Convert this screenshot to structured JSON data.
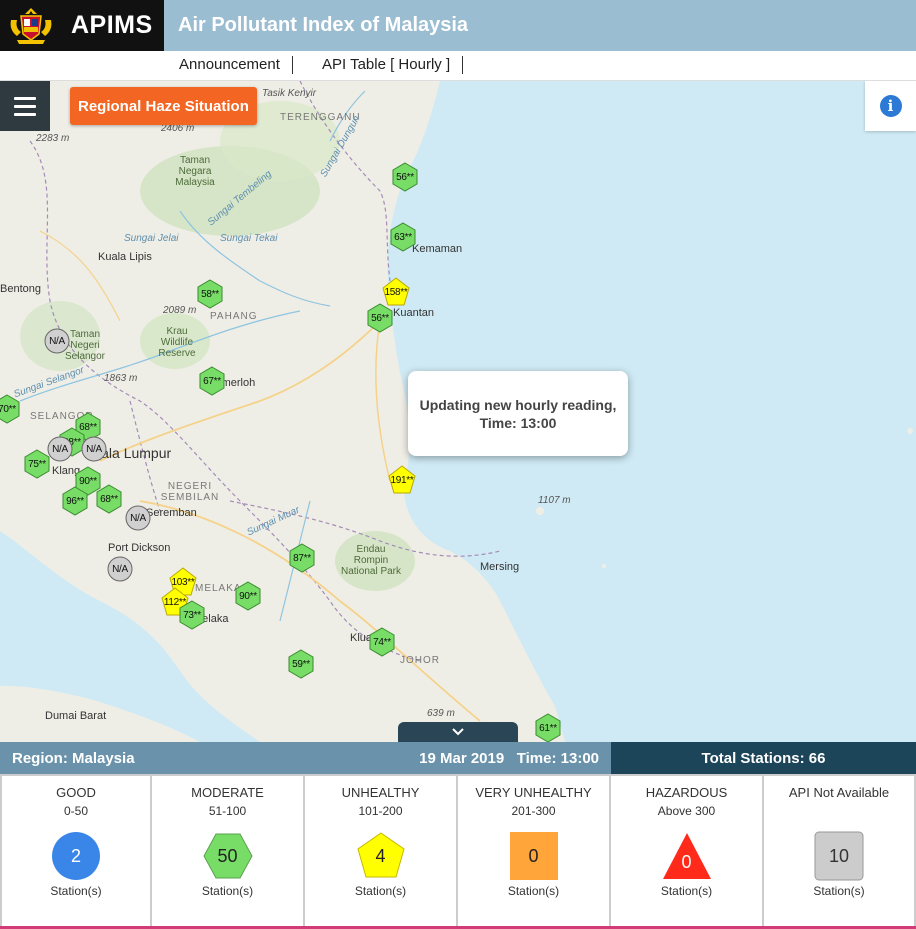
{
  "header": {
    "brand": "APIMS",
    "title": "Air Pollutant Index of Malaysia",
    "crest_icon": "malaysia-coat-of-arms",
    "colors": {
      "brand_bg": "#111111",
      "header_bg": "#9bbdd1"
    }
  },
  "subnav": {
    "items": [
      {
        "label": "Announcement"
      },
      {
        "label": "API Table [ Hourly ]"
      }
    ]
  },
  "map": {
    "haze_button": "Regional Haze Situation",
    "menu_icon": "hamburger-menu-icon",
    "info_icon": "info-icon",
    "info_glyph": "i",
    "popup": {
      "line1": "Updating new hourly reading,",
      "line2": "Time: 13:00"
    },
    "labels": {
      "tasik_kenyir": "Tasik Kenyir",
      "terengganu": "TERENGGANU",
      "h2406": "2406 m",
      "h2283": "2283 m",
      "taman_negara": "Taman Negara Malaysia",
      "sungai_tembeling": "Sungai Tembeling",
      "sungai_dungun": "Sungai Dungun",
      "sungai_jelai": "Sungai Jelai",
      "sungai_tekai": "Sungai Tekai",
      "kuala_lipis": "Kuala Lipis",
      "kemaman": "Kemaman",
      "h2089": "2089 m",
      "pahang": "PAHANG",
      "kuantan": "Kuantan",
      "krau": "Krau Wildlife Reserve",
      "taman_negeri_selangor": "Taman Negeri Selangor",
      "bentong": "Bentong",
      "h1863": "1863 m",
      "temerloh": "Temerloh",
      "selangor": "SELANGOR",
      "sungai_selangor": "Sungai Selangor",
      "kuala_lumpur": "Kuala Lumpur",
      "klang": "Klang",
      "negeri_sembilan": "NEGERI SEMBILAN",
      "seremban": "Seremban",
      "h1107": "1107 m",
      "sungai_muar": "Sungai Muar",
      "port_dickson": "Port Dickson",
      "endau": "Endau Rompin National Park",
      "mersing": "Mersing",
      "melaka": "MELAKA",
      "melaka_city": "Melaka",
      "kluang": "Kluang",
      "johor": "JOHOR",
      "dumai": "Dumai Barat",
      "h639": "639 m"
    },
    "markers": [
      {
        "value": "56**",
        "level": "moderate"
      },
      {
        "value": "63**",
        "level": "moderate"
      },
      {
        "value": "158**",
        "level": "unhealthy"
      },
      {
        "value": "56**",
        "level": "moderate"
      },
      {
        "value": "58**",
        "level": "moderate"
      },
      {
        "value": "N/A",
        "level": "na"
      },
      {
        "value": "67**",
        "level": "moderate"
      },
      {
        "value": "70**",
        "level": "moderate"
      },
      {
        "value": "68**",
        "level": "moderate"
      },
      {
        "value": "68**",
        "level": "moderate"
      },
      {
        "value": "N/A",
        "level": "na"
      },
      {
        "value": "N/A",
        "level": "na"
      },
      {
        "value": "75**",
        "level": "moderate"
      },
      {
        "value": "90**",
        "level": "moderate"
      },
      {
        "value": "96**",
        "level": "moderate"
      },
      {
        "value": "68**",
        "level": "moderate"
      },
      {
        "value": "N/A",
        "level": "na"
      },
      {
        "value": "N/A",
        "level": "na"
      },
      {
        "value": "191**",
        "level": "unhealthy"
      },
      {
        "value": "87**",
        "level": "moderate"
      },
      {
        "value": "103**",
        "level": "unhealthy"
      },
      {
        "value": "112**",
        "level": "unhealthy"
      },
      {
        "value": "73**",
        "level": "moderate"
      },
      {
        "value": "90**",
        "level": "moderate"
      },
      {
        "value": "74**",
        "level": "moderate"
      },
      {
        "value": "59**",
        "level": "moderate"
      },
      {
        "value": "61**",
        "level": "moderate"
      }
    ],
    "expand_icon": "chevron-down-icon"
  },
  "status": {
    "region": "Region: Malaysia",
    "date": "19 Mar 2019",
    "time": "Time: 13:00",
    "total": "Total Stations: 66"
  },
  "legend": [
    {
      "name": "GOOD",
      "range": "0-50",
      "count": "2",
      "station": "Station(s)",
      "shape": "circle",
      "color": "#3a86e8",
      "text_color": "#ffffff"
    },
    {
      "name": "MODERATE",
      "range": "51-100",
      "count": "50",
      "station": "Station(s)",
      "shape": "hexagon",
      "color": "#77dd66",
      "text_color": "#222222"
    },
    {
      "name": "UNHEALTHY",
      "range": "101-200",
      "count": "4",
      "station": "Station(s)",
      "shape": "pentagon",
      "color": "#ffff00",
      "text_color": "#222222"
    },
    {
      "name": "VERY UNHEALTHY",
      "range": "201-300",
      "count": "0",
      "station": "Station(s)",
      "shape": "square",
      "color": "#ffa53a",
      "text_color": "#222222"
    },
    {
      "name": "HAZARDOUS",
      "range": "Above 300",
      "count": "0",
      "station": "Station(s)",
      "shape": "triangle",
      "color": "#ff2a1a",
      "text_color": "#ffffff"
    },
    {
      "name": "API Not Available",
      "range": "",
      "count": "10",
      "station": "Station(s)",
      "shape": "rounded-square",
      "color": "#cccccc",
      "text_color": "#333333"
    }
  ]
}
